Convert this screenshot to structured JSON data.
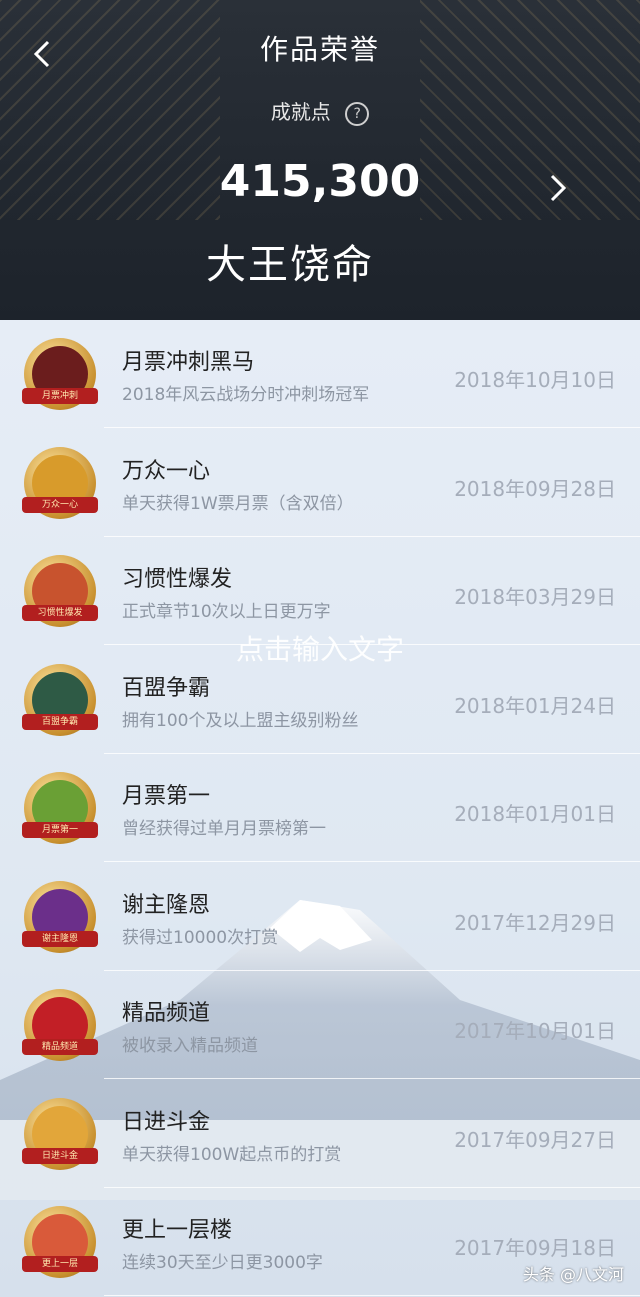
{
  "header": {
    "title": "作品荣誉",
    "achievement_label": "成就点",
    "help_symbol": "?",
    "points": "415,300",
    "book_title": "大王饶命"
  },
  "overlay_text": "点击输入文字",
  "watermark": "头条 @八文河",
  "items": [
    {
      "title": "月票冲刺黑马",
      "desc": "2018年风云战场分时冲刺场冠军",
      "date": "2018年10月10日",
      "badge_text": "月票冲刺",
      "badge_color": "#6b1d1d"
    },
    {
      "title": "万众一心",
      "desc": "单天获得1W票月票（含双倍）",
      "date": "2018年09月28日",
      "badge_text": "万众一心",
      "badge_color": "#d89b2b"
    },
    {
      "title": "习惯性爆发",
      "desc": "正式章节10次以上日更万字",
      "date": "2018年03月29日",
      "badge_text": "习惯性爆发",
      "badge_color": "#c8532e"
    },
    {
      "title": "百盟争霸",
      "desc": "拥有100个及以上盟主级别粉丝",
      "date": "2018年01月24日",
      "badge_text": "百盟争霸",
      "badge_color": "#2e5a45"
    },
    {
      "title": "月票第一",
      "desc": "曾经获得过单月月票榜第一",
      "date": "2018年01月01日",
      "badge_text": "月票第一",
      "badge_color": "#6aa035"
    },
    {
      "title": "谢主隆恩",
      "desc": "获得过10000次打赏",
      "date": "2017年12月29日",
      "badge_text": "谢主隆恩",
      "badge_color": "#6b2f8a"
    },
    {
      "title": "精品频道",
      "desc": "被收录入精品频道",
      "date": "2017年10月01日",
      "badge_text": "精品频道",
      "badge_color": "#c21f26"
    },
    {
      "title": "日进斗金",
      "desc": "单天获得100W起点币的打赏",
      "date": "2017年09月27日",
      "badge_text": "日进斗金",
      "badge_color": "#e2a63a"
    },
    {
      "title": "更上一层楼",
      "desc": "连续30天至少日更3000字",
      "date": "2017年09月18日",
      "badge_text": "更上一层",
      "badge_color": "#d95a3a"
    }
  ]
}
